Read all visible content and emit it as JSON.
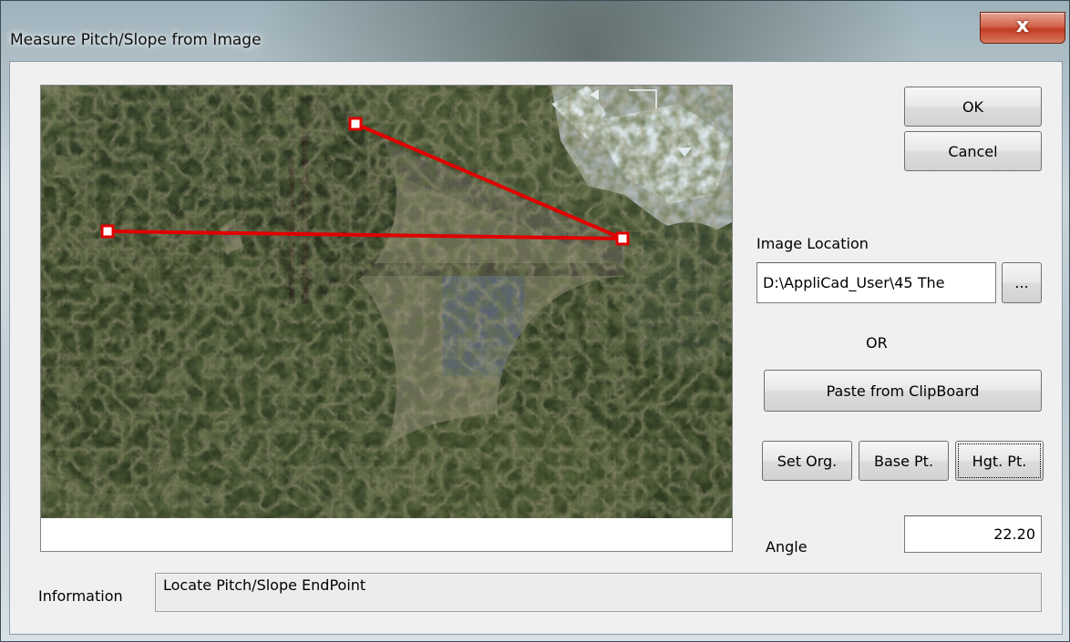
{
  "window": {
    "title": "Measure Pitch/Slope from Image",
    "close_glyph": "x"
  },
  "buttons": {
    "ok": "OK",
    "cancel": "Cancel",
    "browse": "...",
    "paste": "Paste from ClipBoard",
    "set_org": "Set Org.",
    "base_pt": "Base Pt.",
    "hgt_pt": "Hgt. Pt."
  },
  "image_location": {
    "label": "Image Location",
    "value": "D:\\AppliCad_User\\45 The"
  },
  "or_label": "OR",
  "angle": {
    "label": "Angle",
    "value": "22.20"
  },
  "information": {
    "label": "Information",
    "value": "Locate Pitch/Slope EndPoint"
  },
  "measure_overlay": {
    "line_color": "#e00000",
    "points": [
      "origin-point",
      "height-point",
      "base-point"
    ]
  }
}
